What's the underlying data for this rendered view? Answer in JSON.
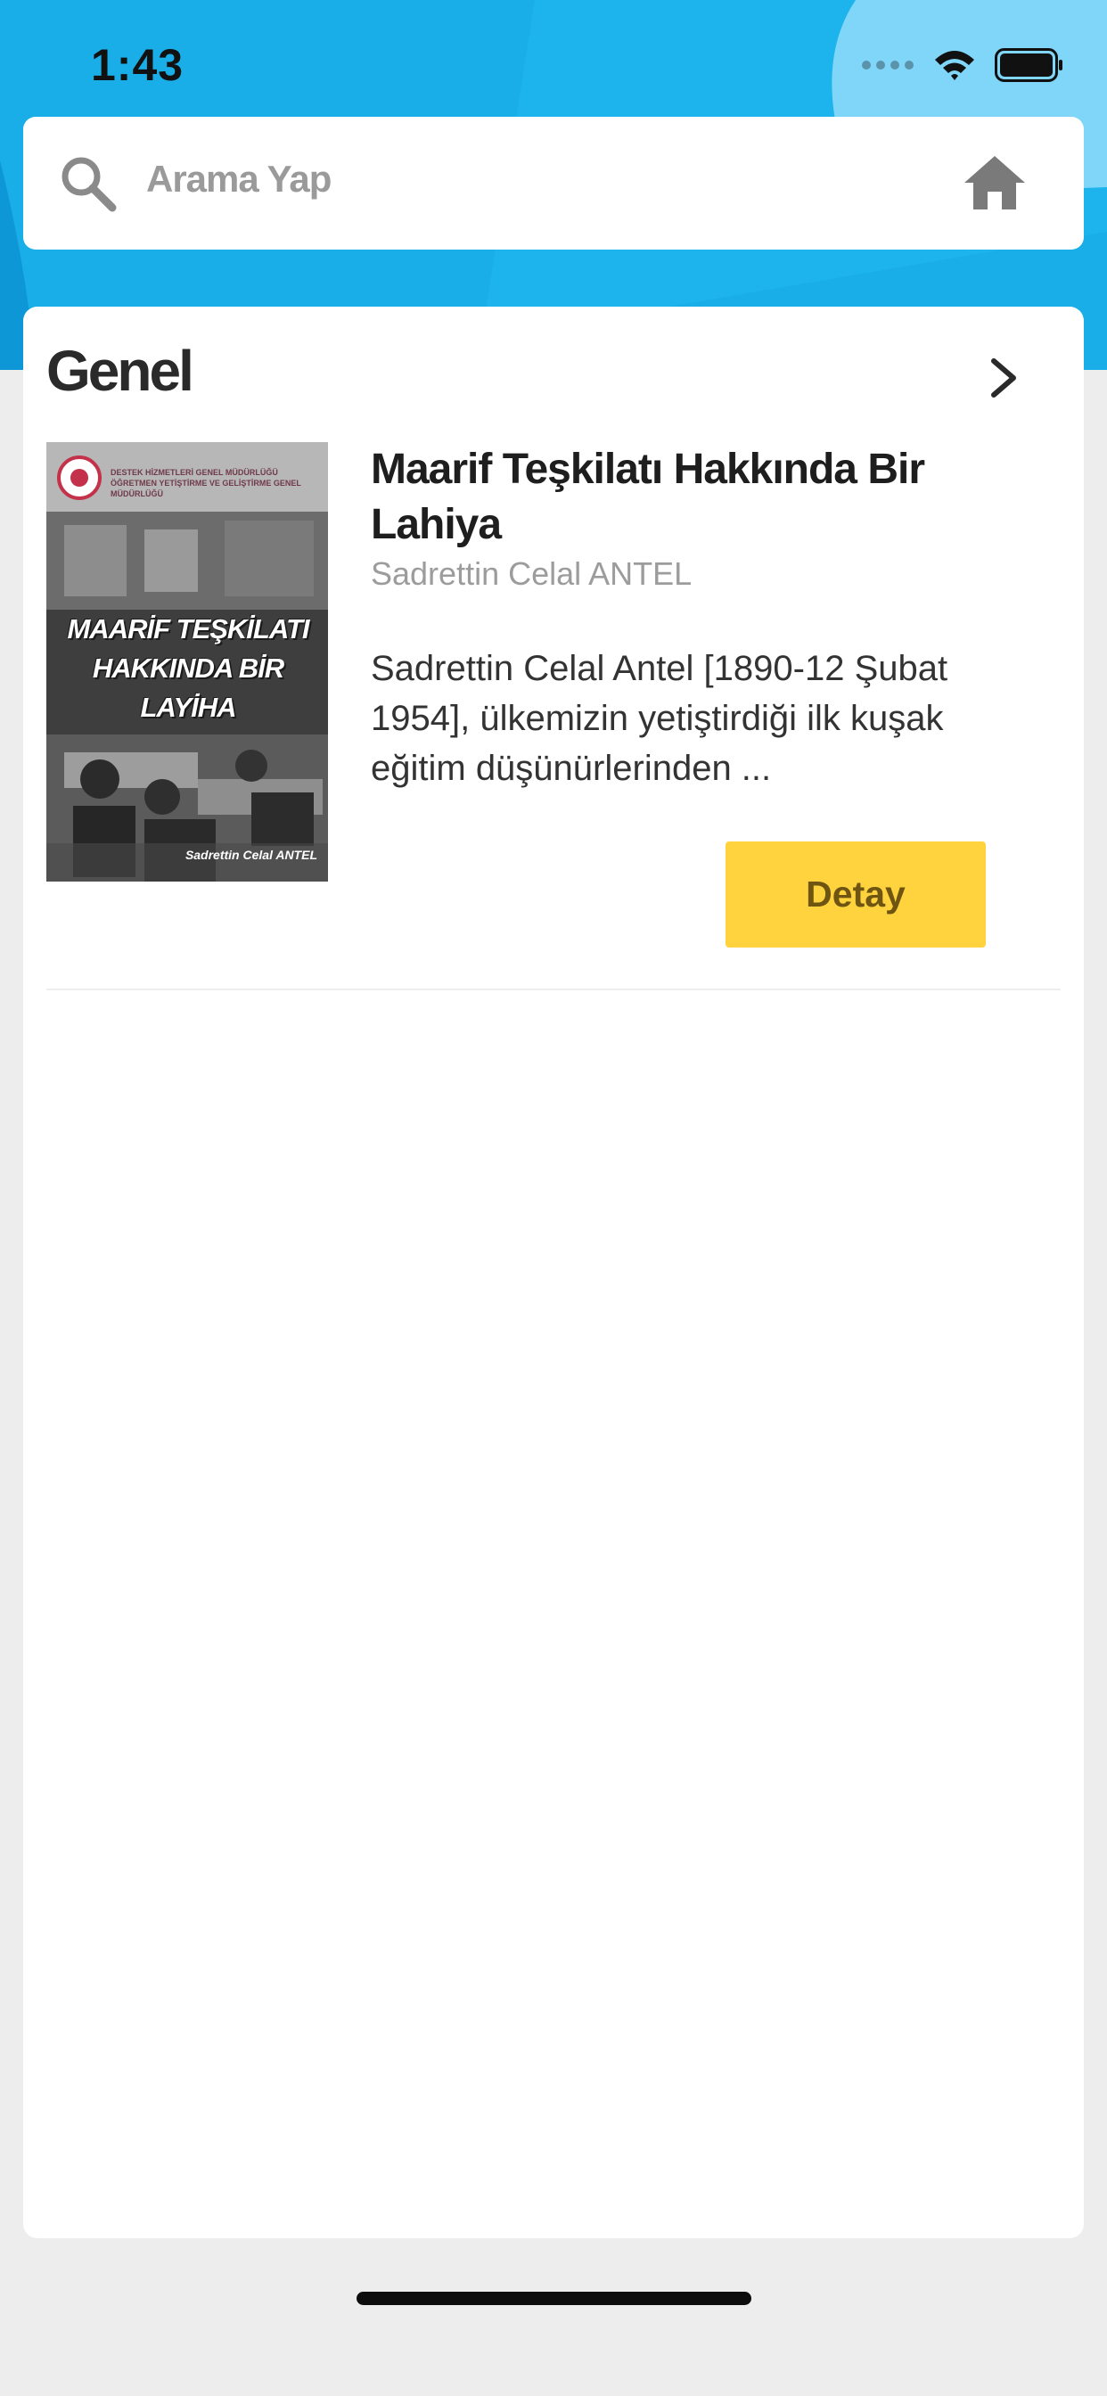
{
  "status_bar": {
    "time": "1:43",
    "icons": [
      "cellular-signal-icon",
      "wifi-icon",
      "battery-icon"
    ]
  },
  "search": {
    "placeholder": "Arama Yap",
    "icons": [
      "search-icon",
      "home-icon"
    ]
  },
  "section": {
    "title": "Genel"
  },
  "book": {
    "title": "Maarif Teşkilatı Hakkında Bir Lahiya",
    "author": "Sadrettin Celal ANTEL",
    "description": "Sadrettin Celal Antel [1890-12 Şubat 1954], ülkemizin yetiştirdiği ilk kuşak eğitim düşünürlerinden ...",
    "detail_button": "Detay",
    "cover": {
      "header_line_1": "DESTEK HİZMETLERİ GENEL MÜDÜRLÜĞÜ",
      "header_line_2": "ÖĞRETMEN YETİŞTİRME VE GELİŞTİRME GENEL MÜDÜRLÜĞÜ",
      "title": "MAARİF TEŞKİLATI HAKKINDA BİR LAYİHA",
      "author": "Sadrettin Celal ANTEL"
    }
  },
  "colors": {
    "header_blue": "#1aaee8",
    "header_light_blue": "#7fd6f8",
    "button_yellow": "#ffd33d",
    "button_text": "#6e5512",
    "page_background": "#ededed"
  }
}
